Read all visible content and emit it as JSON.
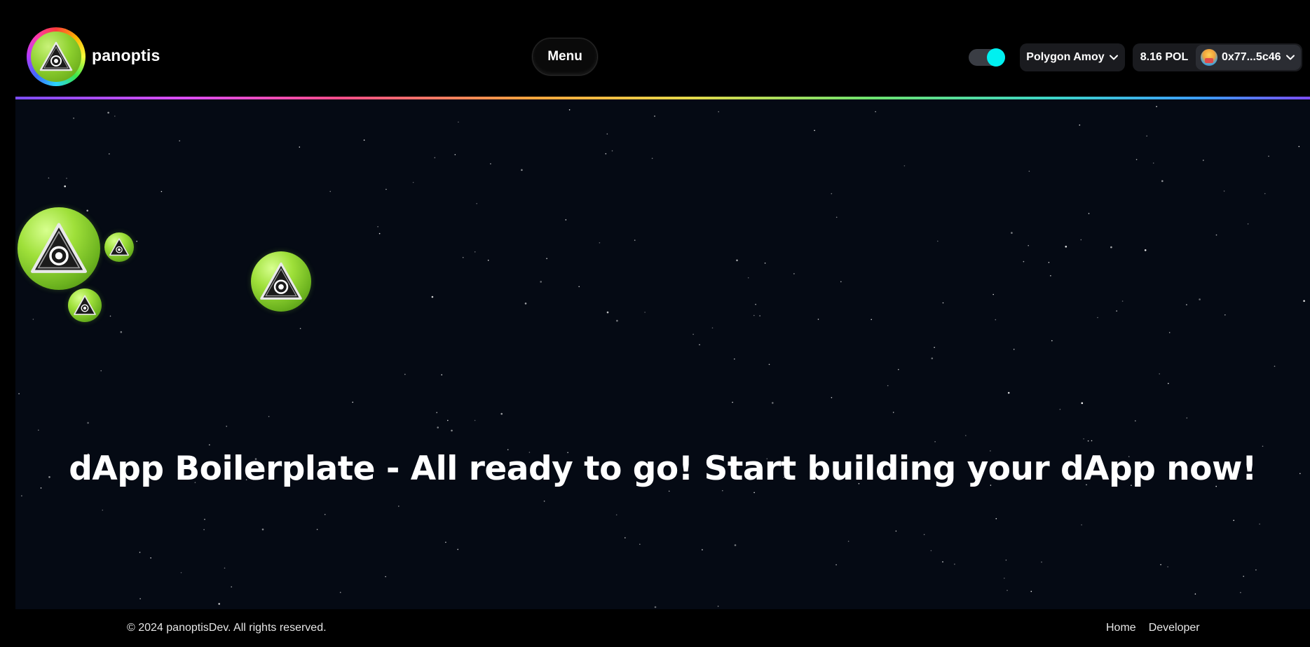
{
  "header": {
    "brand": "panoptis",
    "menu_label": "Menu",
    "theme_toggle_on": true,
    "network_label": "Polygon Amoy",
    "balance_label": "8.16 POL",
    "address_label": "0x77...5c46"
  },
  "main": {
    "hero_title": "dApp Boilerplate - All ready to go! Start building your dApp now!"
  },
  "footer": {
    "copyright": "© 2024 panoptisDev. All rights reserved.",
    "links": [
      "Home",
      "Developer"
    ]
  },
  "colors": {
    "background": "#000000",
    "canvas": "#050a14",
    "toggle_accent": "#00f0f0",
    "orb_green": "#8ed12f",
    "pill_bg": "#1a1b1f"
  },
  "icons": {
    "logo": "panoptis-eye-triangle-icon",
    "chevron": "chevron-down-icon",
    "avatar": "wallet-avatar-icon"
  }
}
